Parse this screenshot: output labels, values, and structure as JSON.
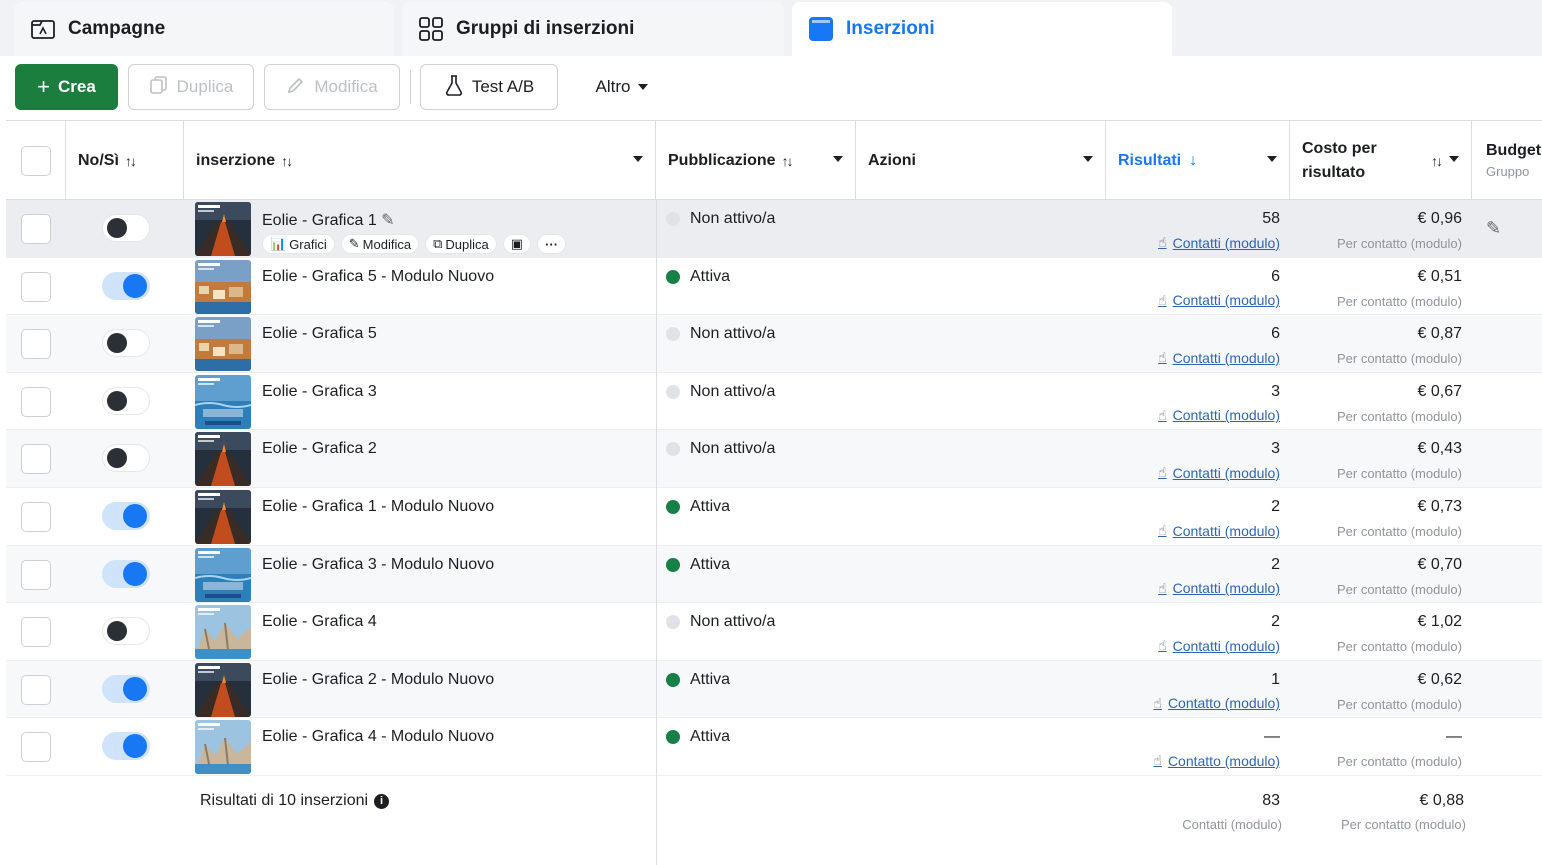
{
  "tabs": [
    {
      "label": "Campagne",
      "icon": "campaign-icon",
      "active": false
    },
    {
      "label": "Gruppi di inserzioni",
      "icon": "grid-icon",
      "active": false
    },
    {
      "label": "Inserzioni",
      "icon": "ad-icon",
      "active": true
    }
  ],
  "toolbar": {
    "create": "Crea",
    "duplicate": "Duplica",
    "edit": "Modifica",
    "abtest": "Test A/B",
    "more": "Altro"
  },
  "columns": {
    "onoff": "No/Sì",
    "ad": "inserzione",
    "delivery": "Pubblicazione",
    "actions": "Azioni",
    "results": "Risultati",
    "cost": "Costo per risultato",
    "budget": "Budget",
    "budget_sub": "Gruppo"
  },
  "row_actions": {
    "charts": "Grafici",
    "edit": "Modifica",
    "duplicate": "Duplica"
  },
  "rows": [
    {
      "name": "Eolie - Grafica 1",
      "on": false,
      "status": "Non attivo/a",
      "active": false,
      "result": "58",
      "result_label": "Contatti (modulo)",
      "cost": "€ 0,96",
      "cost_label": "Per contatto (modulo)",
      "thumb": "volcano"
    },
    {
      "name": "Eolie - Grafica 5 - Modulo Nuovo",
      "on": true,
      "status": "Attiva",
      "active": true,
      "result": "6",
      "result_label": "Contatti (modulo)",
      "cost": "€ 0,51",
      "cost_label": "Per contatto (modulo)",
      "thumb": "village"
    },
    {
      "name": "Eolie - Grafica 5",
      "on": false,
      "status": "Non attivo/a",
      "active": false,
      "result": "6",
      "result_label": "Contatti (modulo)",
      "cost": "€ 0,87",
      "cost_label": "Per contatto (modulo)",
      "thumb": "village"
    },
    {
      "name": "Eolie - Grafica 3",
      "on": false,
      "status": "Non attivo/a",
      "active": false,
      "result": "3",
      "result_label": "Contatti (modulo)",
      "cost": "€ 0,67",
      "cost_label": "Per contatto (modulo)",
      "thumb": "sea"
    },
    {
      "name": "Eolie - Grafica 2",
      "on": false,
      "status": "Non attivo/a",
      "active": false,
      "result": "3",
      "result_label": "Contatti (modulo)",
      "cost": "€ 0,43",
      "cost_label": "Per contatto (modulo)",
      "thumb": "volcano"
    },
    {
      "name": "Eolie - Grafica 1 - Modulo Nuovo",
      "on": true,
      "status": "Attiva",
      "active": true,
      "result": "2",
      "result_label": "Contatti (modulo)",
      "cost": "€ 0,73",
      "cost_label": "Per contatto (modulo)",
      "thumb": "volcano"
    },
    {
      "name": "Eolie - Grafica 3 - Modulo Nuovo",
      "on": true,
      "status": "Attiva",
      "active": true,
      "result": "2",
      "result_label": "Contatti (modulo)",
      "cost": "€ 0,70",
      "cost_label": "Per contatto (modulo)",
      "thumb": "sea"
    },
    {
      "name": "Eolie - Grafica 4",
      "on": false,
      "status": "Non attivo/a",
      "active": false,
      "result": "2",
      "result_label": "Contatti (modulo)",
      "cost": "€ 1,02",
      "cost_label": "Per contatto (modulo)",
      "thumb": "rocks"
    },
    {
      "name": "Eolie - Grafica 2 - Modulo Nuovo",
      "on": true,
      "status": "Attiva",
      "active": true,
      "result": "1",
      "result_label": "Contatto (modulo)",
      "cost": "€ 0,62",
      "cost_label": "Per contatto (modulo)",
      "thumb": "volcano"
    },
    {
      "name": "Eolie - Grafica 4 - Modulo Nuovo",
      "on": true,
      "status": "Attiva",
      "active": true,
      "result": "—",
      "result_label": "Contatto (modulo)",
      "cost": "—",
      "cost_label": "Per contatto (modulo)",
      "thumb": "rocks"
    }
  ],
  "footer": {
    "label": "Risultati di 10 inserzioni",
    "result": "83",
    "result_label": "Contatti (modulo)",
    "cost": "€ 0,88",
    "cost_label": "Per contatto (modulo)"
  },
  "colors": {
    "accent": "#1877f2",
    "create": "#1b7d3e",
    "active_dot": "#168046",
    "link": "#2d65b5"
  }
}
